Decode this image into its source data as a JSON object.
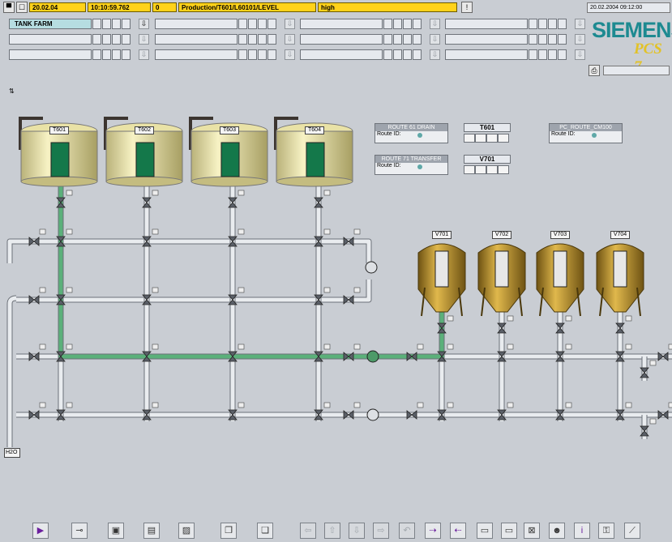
{
  "alarm_line": {
    "date": "20.02.04",
    "time": "10:10:59.762",
    "num": "0",
    "tag": "Production/T601/L60101/LEVEL",
    "state": "high"
  },
  "header": {
    "datetime": "20.02.2004 09:12:00",
    "brand": "SIEMENS",
    "product": "PCS 7"
  },
  "overview": {
    "areas": [
      "TANK FARM",
      "",
      "",
      "",
      "",
      "",
      "",
      "",
      "",
      "",
      "",
      ""
    ]
  },
  "routes": {
    "route61": {
      "title": "ROUTE 61 DRAIN",
      "label": "Route ID:"
    },
    "route71": {
      "title": "ROUTE 71 TRANSFER",
      "label": "Route ID:"
    },
    "pc_route": {
      "title": "PC_ROUTE_CM100",
      "label": "Route ID:"
    },
    "t601_btn": "T601",
    "v701_btn": "V701"
  },
  "tanks": [
    {
      "id": "T601",
      "label": "T601"
    },
    {
      "id": "T602",
      "label": "T602"
    },
    {
      "id": "T603",
      "label": "T603"
    },
    {
      "id": "T604",
      "label": "T604"
    }
  ],
  "vessels": [
    {
      "id": "V701",
      "label": "V701"
    },
    {
      "id": "V702",
      "label": "V702"
    },
    {
      "id": "V703",
      "label": "V703"
    },
    {
      "id": "V704",
      "label": "V704"
    }
  ],
  "water_label": "H2O",
  "colors": {
    "pipe": "#e9ecef",
    "pipe_active": "#5bb07a",
    "tank_body": "#f0eab4",
    "tank_level": "#14784a",
    "vessel": "#b38a2e",
    "accent": "#1d8a91"
  },
  "toolbar": [
    "play-icon",
    "valve-icon",
    "folder-icon",
    "print-icon",
    "chart-icon",
    "copy-icon",
    "paste-icon",
    "left-icon",
    "up-icon",
    "down-icon",
    "right-icon",
    "undo-icon",
    "forward-icon",
    "back-icon",
    "window-icon",
    "window2-icon",
    "mixer-icon",
    "user-icon",
    "info-icon",
    "key-icon",
    "trend-icon"
  ]
}
